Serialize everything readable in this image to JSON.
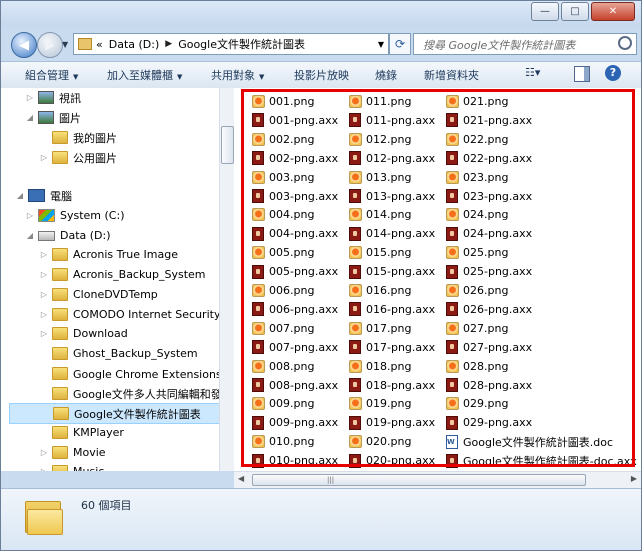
{
  "window": {
    "min_glyph": "—",
    "max_glyph": "□",
    "close_glyph": "✕"
  },
  "address": {
    "prefix": "«",
    "drive": "Data (D:)",
    "folder": "Google文件製作統計圖表"
  },
  "search": {
    "placeholder": "搜尋 Google文件製作統計圖表"
  },
  "toolbar": {
    "organize": "組合管理",
    "include_library": "加入至媒體櫃",
    "share": "共用對象",
    "slideshow": "投影片放映",
    "burn": "燒錄",
    "new_folder": "新增資料夾",
    "help": "?"
  },
  "nav": {
    "items": [
      {
        "label": "視訊",
        "icon": "video-icon",
        "expander": "▷"
      },
      {
        "label": "圖片",
        "icon": "pictures-icon",
        "expander": "◢"
      },
      {
        "label": "我的圖片",
        "icon": "folder-icon",
        "expander": ""
      },
      {
        "label": "公用圖片",
        "icon": "folder-icon",
        "expander": "▷"
      },
      {
        "label": "電腦",
        "icon": "computer-icon",
        "expander": "◢"
      },
      {
        "label": "System (C:)",
        "icon": "system-drive-icon",
        "expander": "▷"
      },
      {
        "label": "Data (D:)",
        "icon": "drive-icon",
        "expander": "◢"
      },
      {
        "label": "Acronis True Image",
        "icon": "folder-icon",
        "expander": "▷"
      },
      {
        "label": "Acronis_Backup_System",
        "icon": "folder-icon",
        "expander": "▷"
      },
      {
        "label": "CloneDVDTemp",
        "icon": "folder-icon",
        "expander": "▷"
      },
      {
        "label": "COMODO Internet Security",
        "icon": "folder-icon",
        "expander": "▷"
      },
      {
        "label": "Download",
        "icon": "folder-icon",
        "expander": "▷"
      },
      {
        "label": "Ghost_Backup_System",
        "icon": "folder-icon",
        "expander": ""
      },
      {
        "label": "Google Chrome Extensions(二)",
        "icon": "folder-icon",
        "expander": ""
      },
      {
        "label": "Google文件多人共同編輯和發佈",
        "icon": "folder-icon",
        "expander": ""
      },
      {
        "label": "Google文件製作統計圖表",
        "icon": "folder-icon",
        "expander": ""
      },
      {
        "label": "KMPlayer",
        "icon": "folder-icon",
        "expander": ""
      },
      {
        "label": "Movie",
        "icon": "folder-icon",
        "expander": "▷"
      },
      {
        "label": "Music",
        "icon": "folder-icon",
        "expander": "▷"
      }
    ]
  },
  "files": {
    "col1": [
      "001.png",
      "001-png.axx",
      "002.png",
      "002-png.axx",
      "003.png",
      "003-png.axx",
      "004.png",
      "004-png.axx",
      "005.png",
      "005-png.axx",
      "006.png",
      "006-png.axx",
      "007.png",
      "007-png.axx",
      "008.png",
      "008-png.axx",
      "009.png",
      "009-png.axx",
      "010.png",
      "010-png.axx"
    ],
    "col2": [
      "011.png",
      "011-png.axx",
      "012.png",
      "012-png.axx",
      "013.png",
      "013-png.axx",
      "014.png",
      "014-png.axx",
      "015.png",
      "015-png.axx",
      "016.png",
      "016-png.axx",
      "017.png",
      "017-png.axx",
      "018.png",
      "018-png.axx",
      "019.png",
      "019-png.axx",
      "020.png",
      "020-png.axx"
    ],
    "col3": [
      "021.png",
      "021-png.axx",
      "022.png",
      "022-png.axx",
      "023.png",
      "023-png.axx",
      "024.png",
      "024-png.axx",
      "025.png",
      "025-png.axx",
      "026.png",
      "026-png.axx",
      "027.png",
      "027-png.axx",
      "028.png",
      "028-png.axx",
      "029.png",
      "029-png.axx",
      "Google文件製作統計圖表.doc",
      "Google文件製作統計圖表-doc.axx"
    ]
  },
  "status": {
    "item_count": "60 個項目"
  },
  "colors": {
    "highlight_border": "#e60000",
    "selection": "#cce8ff"
  }
}
